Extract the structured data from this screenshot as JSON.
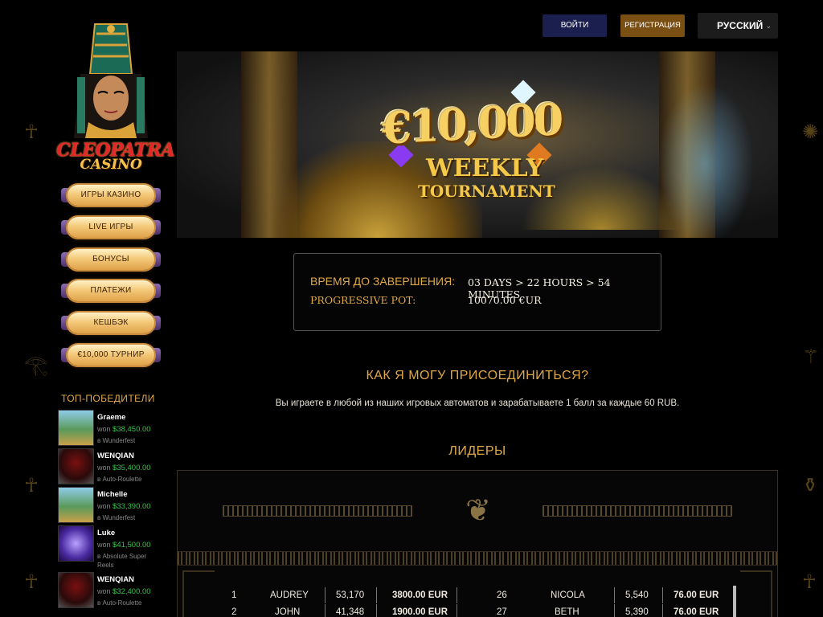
{
  "header": {
    "login_label": "ВОЙТИ",
    "register_label": "РЕГИСТРАЦИЯ",
    "language": "РУССКИЙ"
  },
  "logo": {
    "line1": "CLEOPATRA",
    "line2": "CASINO"
  },
  "menu": [
    {
      "label": "ИГРЫ КАЗИНО"
    },
    {
      "label": "LIVE ИГРЫ"
    },
    {
      "label": "БОНУСЫ"
    },
    {
      "label": "ПЛАТЕЖИ"
    },
    {
      "label": "КЕШБЭК"
    },
    {
      "label": "€10,000 ТУРНИР"
    }
  ],
  "winners": {
    "title": "ТОП-ПОБЕДИТЕЛИ",
    "items": [
      {
        "name": "Graeme",
        "won_prefix": "won",
        "amount": "$38,450.00",
        "game": "в Wunderfest"
      },
      {
        "name": "WENQIAN",
        "won_prefix": "won",
        "amount": "$35,400.00",
        "game": "в Auto-Roulette"
      },
      {
        "name": "Michelle",
        "won_prefix": "won",
        "amount": "$33,390.00",
        "game": "в Wunderfest"
      },
      {
        "name": "Luke",
        "won_prefix": "won",
        "amount": "$41,500.00",
        "game": "в Absolute Super Reels"
      },
      {
        "name": "WENQIAN",
        "won_prefix": "won",
        "amount": "$32,400.00",
        "game": "в Auto-Roulette"
      }
    ]
  },
  "banner": {
    "amount": "€10,000",
    "line1": "WEEKLY",
    "line2": "TOURNAMENT"
  },
  "info": {
    "time_label": "ВРЕМЯ ДО ЗАВЕРШЕНИЯ:",
    "time_value": "03 DAYS > 22 HOURS > 54 MINUTES",
    "pot_label": "PROGRESSIVE POT:",
    "pot_value": "10070.00 €UR"
  },
  "how": {
    "title": "КАК Я МОГУ ПРИСОЕДИНИТЬСЯ?",
    "text": "Вы играете в любой из наших игровых автоматов и зарабатываете 1 балл за каждые 60 RUB."
  },
  "leaders": {
    "title": "ЛИДЕРЫ",
    "rows": [
      {
        "rank": "1",
        "name": "AUDREY",
        "points": "53,170",
        "prize": "3800.00 EUR",
        "rank2": "26",
        "name2": "NICOLA",
        "points2": "5,540",
        "prize2": "76.00 EUR"
      },
      {
        "rank": "2",
        "name": "JOHN",
        "points": "41,348",
        "prize": "1900.00 EUR",
        "rank2": "27",
        "name2": "BETH",
        "points2": "5,390",
        "prize2": "76.00 EUR"
      }
    ]
  },
  "colors": {
    "gold": "#e0a948",
    "login_bg": "#1b1f4e",
    "register_bg": "#7a4f14",
    "won_green": "#35c24a"
  }
}
